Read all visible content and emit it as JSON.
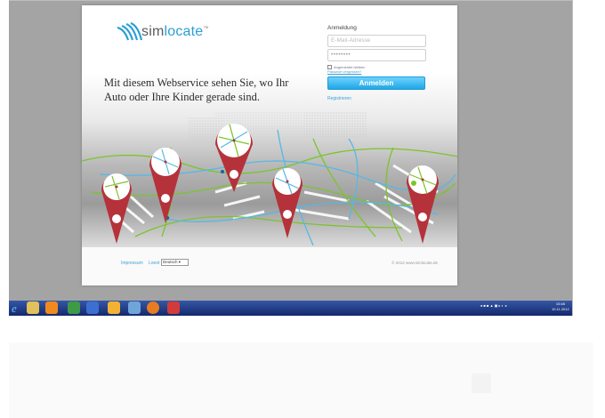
{
  "site": {
    "brand": {
      "prefix": "sim",
      "suffix": "locate",
      "tm": "™"
    },
    "tagline": "Mit diesem Webservice sehen Sie, wo Ihr Auto oder Ihre Kinder gerade sind.",
    "login": {
      "title": "Anmeldung",
      "email_placeholder": "E-Mail-Adresse",
      "password_value": "••••••••",
      "remember_label": "Angemeldet bleiben",
      "forgot_label": "Passwort vergessen?",
      "submit_label": "Anmelden",
      "register_label": "Registrieren"
    },
    "footer": {
      "imprint": "Impressum",
      "loest": "Loest",
      "language_selected": "Deutsch",
      "copyright": "© 2012 www.simlocate.de"
    }
  },
  "taskbar": {
    "apps": [
      "internet-explorer",
      "windows-explorer",
      "media-player",
      "excel",
      "word",
      "outlook",
      "paint",
      "firefox",
      "acrobat"
    ],
    "clock": {
      "time": "10:48",
      "date": "10.11.2012"
    }
  },
  "colors": {
    "accent": "#2b9fd6",
    "pin": "#b5323a",
    "road_green": "#7cc42c",
    "road_blue": "#56b8e6",
    "taskbar": "#1e3a8a"
  }
}
